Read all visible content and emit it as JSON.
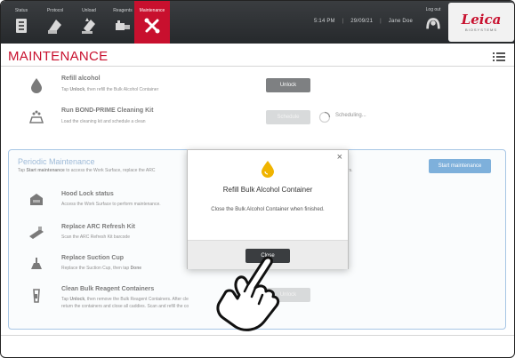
{
  "nav": {
    "items": [
      {
        "label": "Status",
        "icon": "status-icon"
      },
      {
        "label": "Protocol",
        "icon": "protocol-icon"
      },
      {
        "label": "Unload",
        "icon": "unload-icon"
      },
      {
        "label": "Reagents",
        "icon": "reagents-icon"
      },
      {
        "label": "Maintenance",
        "icon": "maintenance-icon",
        "active": true
      }
    ],
    "time": "5:14 PM",
    "date": "29/09/21",
    "user": "Jane Doe",
    "logout_label": "Log out",
    "brand": "Leica",
    "brand_sub": "BIOSYSTEMS"
  },
  "page": {
    "title": "MAINTENANCE"
  },
  "tasks": {
    "refill": {
      "title": "Refill alcohol",
      "desc_pre": "Tap ",
      "desc_bold": "Unlock",
      "desc_post": ", then refill the Bulk Alcohol Container",
      "button": "Unlock"
    },
    "bond": {
      "title": "Run BOND-PRIME Cleaning Kit",
      "desc": "Load the cleaning kit and schedule a clean",
      "button": "Schedule",
      "status": "Scheduling..."
    }
  },
  "periodic": {
    "title": "Periodic Maintenance",
    "desc_pre": "Tap ",
    "desc_bold": "Start maintenance",
    "desc_post": " to access the Work Surface, replace the ARC",
    "desc_tail": "Containers.",
    "button": "Start maintenance",
    "items": [
      {
        "title": "Hood Lock status",
        "desc": "Access the Work Surface to perform maintenance."
      },
      {
        "title": "Replace ARC Refresh Kit",
        "desc": "Scan the ARC Refresh Kit barcode"
      },
      {
        "title": "Replace Suction Cup",
        "desc_pre": "Replace the Suction Cup, then tap ",
        "desc_bold": "Done"
      },
      {
        "title": "Clean Bulk Reagent Containers",
        "desc_pre": "Tap ",
        "desc_bold": "Unlock",
        "desc_post": ", then remove the Bulk Reagent Containers. After cle",
        "desc2": "return the containers and close all caddies. Scan and refill the co",
        "button": "Unlock"
      }
    ]
  },
  "modal": {
    "title": "Refill Bulk Alcohol Container",
    "body": "Close the Bulk Alcohol Container when finished.",
    "close_label": "Close",
    "x_label": "×"
  },
  "colors": {
    "accent": "#c8102e",
    "blue": "#3a86c8",
    "dark": "#3a3d40"
  }
}
